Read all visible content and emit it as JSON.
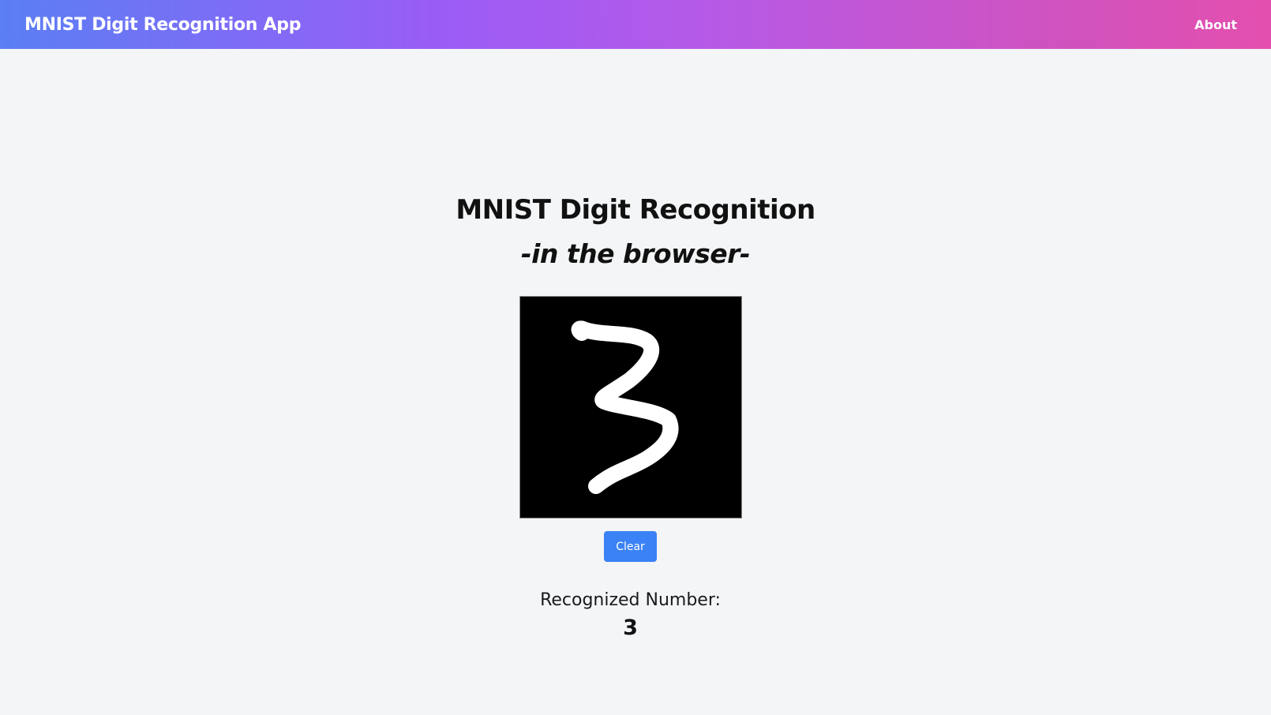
{
  "navbar": {
    "brand": "MNIST Digit Recognition App",
    "about_label": "About",
    "gradient_colors": [
      "#5b7ff5",
      "#9b5cf6",
      "#d152bd",
      "#e44fae"
    ]
  },
  "main": {
    "title": "MNIST Digit Recognition",
    "subtitle": "-in the browser-",
    "drawing": {
      "background": "#000000",
      "stroke_color": "#ffffff",
      "digit_drawn": "3"
    },
    "clear_label": "Clear",
    "clear_color": "#3b82f6",
    "result_label": "Recognized Number:",
    "result_value": "3"
  }
}
